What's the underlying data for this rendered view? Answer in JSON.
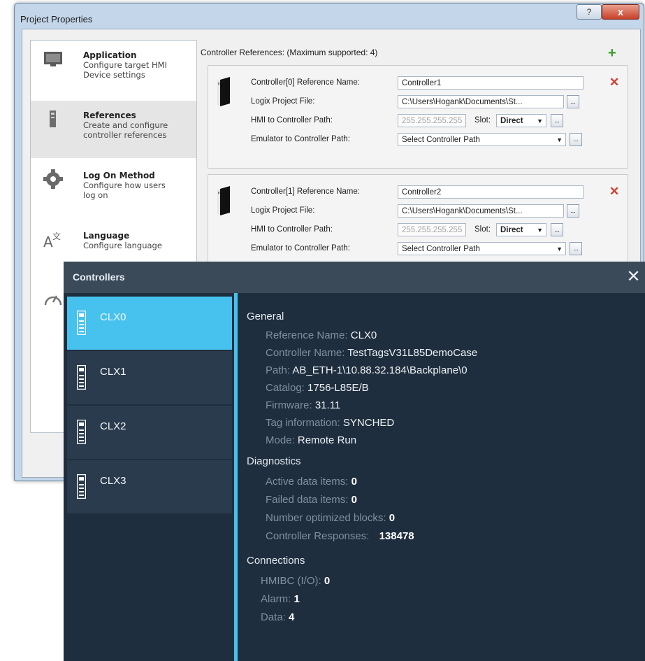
{
  "project_properties": {
    "title": "Project Properties",
    "help_label": "?",
    "close_label": "x",
    "nav": [
      {
        "title": "Application",
        "desc1": "Configure target HMI",
        "desc2": "Device settings",
        "icon": "monitor-icon"
      },
      {
        "title": "References",
        "desc1": "Create and configure",
        "desc2": "controller references",
        "icon": "controller-icon"
      },
      {
        "title": "Log On Method",
        "desc1": "Configure how users",
        "desc2": "log on",
        "icon": "gear-icon"
      },
      {
        "title": "Language",
        "desc1": "Configure language",
        "desc2": "",
        "icon": "language-icon"
      }
    ],
    "references_header": "Controller References:  (Maximum supported: 4)",
    "add_label": "+",
    "labels": {
      "logix_file": "Logix Project File:",
      "hmi_path": "HMI to Controller Path:",
      "slot": "Slot:",
      "emulator_path": "Emulator to Controller Path:",
      "browse": "..."
    },
    "controllers": [
      {
        "name_label": "Controller[0] Reference Name:",
        "name": "Controller1",
        "file": "C:\\Users\\Hogank\\Documents\\St...",
        "ip": "255.255.255.255",
        "slot": "Direct",
        "emulator_path": "Select Controller Path"
      },
      {
        "name_label": "Controller[1] Reference Name:",
        "name": "Controller2",
        "file": "C:\\Users\\Hogank\\Documents\\St...",
        "ip": "255.255.255.255",
        "slot": "Direct",
        "emulator_path": "Select Controller Path"
      }
    ],
    "remove_label": "✕"
  },
  "controllers_window": {
    "title": "Controllers",
    "close_label": "✕",
    "items": [
      {
        "label": "CLX0",
        "selected": true
      },
      {
        "label": "CLX1",
        "selected": false
      },
      {
        "label": "CLX2",
        "selected": false
      },
      {
        "label": "CLX3",
        "selected": false
      }
    ],
    "general": {
      "heading": "General",
      "reference_name_label": "Reference Name:",
      "reference_name": "CLX0",
      "controller_name_label": "Controller Name:",
      "controller_name": "TestTagsV31L85DemoCase",
      "path_label": "Path:",
      "path": "AB_ETH-1\\10.88.32.184\\Backplane\\0",
      "catalog_label": "Catalog:",
      "catalog": "1756-L85E/B",
      "firmware_label": "Firmware:",
      "firmware": "31.11",
      "tag_info_label": "Tag information:",
      "tag_info": "SYNCHED",
      "mode_label": "Mode:",
      "mode": "Remote Run"
    },
    "diagnostics": {
      "heading": "Diagnostics",
      "active_label": "Active data items:",
      "active": "0",
      "failed_label": "Failed data items:",
      "failed": "0",
      "optimized_label": "Number optimized blocks:",
      "optimized": "0",
      "responses_label": "Controller Responses:",
      "responses": "138478"
    },
    "connections": {
      "heading": "Connections",
      "hmibc_label": "HMIBC (I/O):",
      "hmibc": "0",
      "alarm_label": "Alarm:",
      "alarm": "1",
      "data_label": "Data:",
      "data": "4"
    }
  }
}
